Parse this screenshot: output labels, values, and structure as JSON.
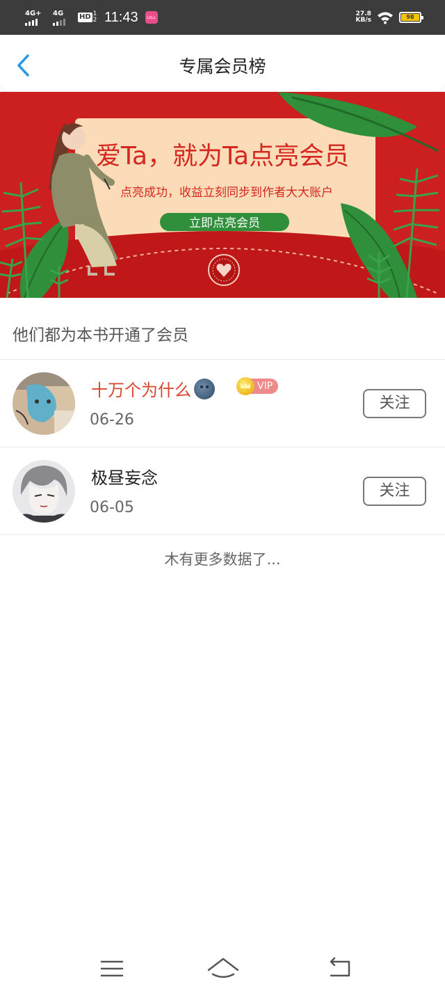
{
  "status_bar": {
    "signal1_label": "4G+",
    "signal2_label": "4G",
    "hd_label": "HD",
    "hd_sub": "1 2",
    "time": "11:43",
    "app_icon_text": "ʟɪʟʟ",
    "net_speed": "27.8",
    "net_unit": "KB/s",
    "battery_level": "98"
  },
  "header": {
    "title": "专属会员榜"
  },
  "banner": {
    "headline": "爱Ta，就为Ta点亮会员",
    "subline": "点亮成功，收益立刻同步到作者大大账户",
    "cta": "立即点亮会员"
  },
  "section": {
    "title": "他们都为本书开通了会员"
  },
  "members": [
    {
      "name": "十万个为什么",
      "date": "06-26",
      "vip_label": "VIP",
      "follow_label": "关注"
    },
    {
      "name": "极昼妄念",
      "date": "06-05",
      "follow_label": "关注"
    }
  ],
  "footer": {
    "no_more": "木有更多数据了..."
  },
  "colors": {
    "accent_blue": "#2a9ae6",
    "vip_name": "#d9462e",
    "banner_red": "#cc1f1f",
    "banner_green": "#2f8f3a"
  }
}
